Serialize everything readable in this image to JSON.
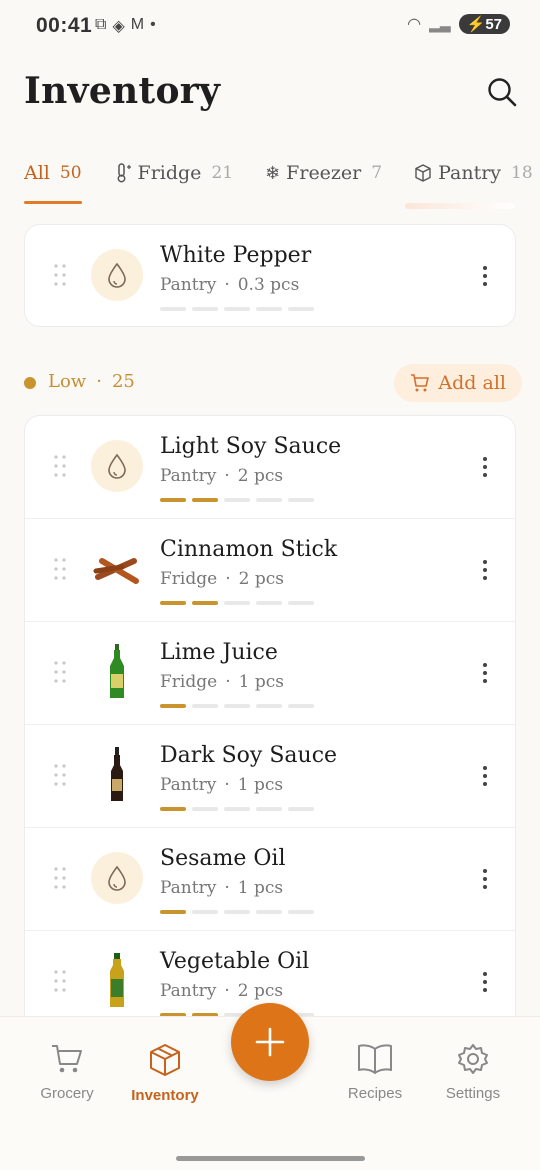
{
  "status": {
    "time": "00:41",
    "battery": "57"
  },
  "header": {
    "title": "Inventory"
  },
  "tabs": [
    {
      "label": "All",
      "count": "50"
    },
    {
      "label": "Fridge",
      "count": "21"
    },
    {
      "label": "Freezer",
      "count": "7"
    },
    {
      "label": "Pantry",
      "count": "18"
    }
  ],
  "pinned": {
    "name": "White Pepper",
    "location": "Pantry",
    "qty": "0.3 pcs",
    "level": 0
  },
  "low": {
    "label": "Low",
    "count": "25",
    "add_all": "Add all"
  },
  "items": [
    {
      "name": "Light Soy Sauce",
      "location": "Pantry",
      "qty": "2 pcs",
      "level": 2,
      "icon": "drop-icon"
    },
    {
      "name": "Cinnamon Stick",
      "location": "Fridge",
      "qty": "2 pcs",
      "level": 2,
      "icon": "cinnamon-icon"
    },
    {
      "name": "Lime Juice",
      "location": "Fridge",
      "qty": "1 pcs",
      "level": 1,
      "icon": "green-bottle-icon"
    },
    {
      "name": "Dark Soy Sauce",
      "location": "Pantry",
      "qty": "1 pcs",
      "level": 1,
      "icon": "dark-bottle-icon"
    },
    {
      "name": "Sesame Oil",
      "location": "Pantry",
      "qty": "1 pcs",
      "level": 1,
      "icon": "drop-icon"
    },
    {
      "name": "Vegetable Oil",
      "location": "Pantry",
      "qty": "2 pcs",
      "level": 2,
      "icon": "oil-bottle-icon"
    }
  ],
  "nav": {
    "grocery": "Grocery",
    "inventory": "Inventory",
    "recipes": "Recipes",
    "settings": "Settings"
  },
  "colors": {
    "accent": "#dd7418",
    "level": "#c9932e"
  }
}
